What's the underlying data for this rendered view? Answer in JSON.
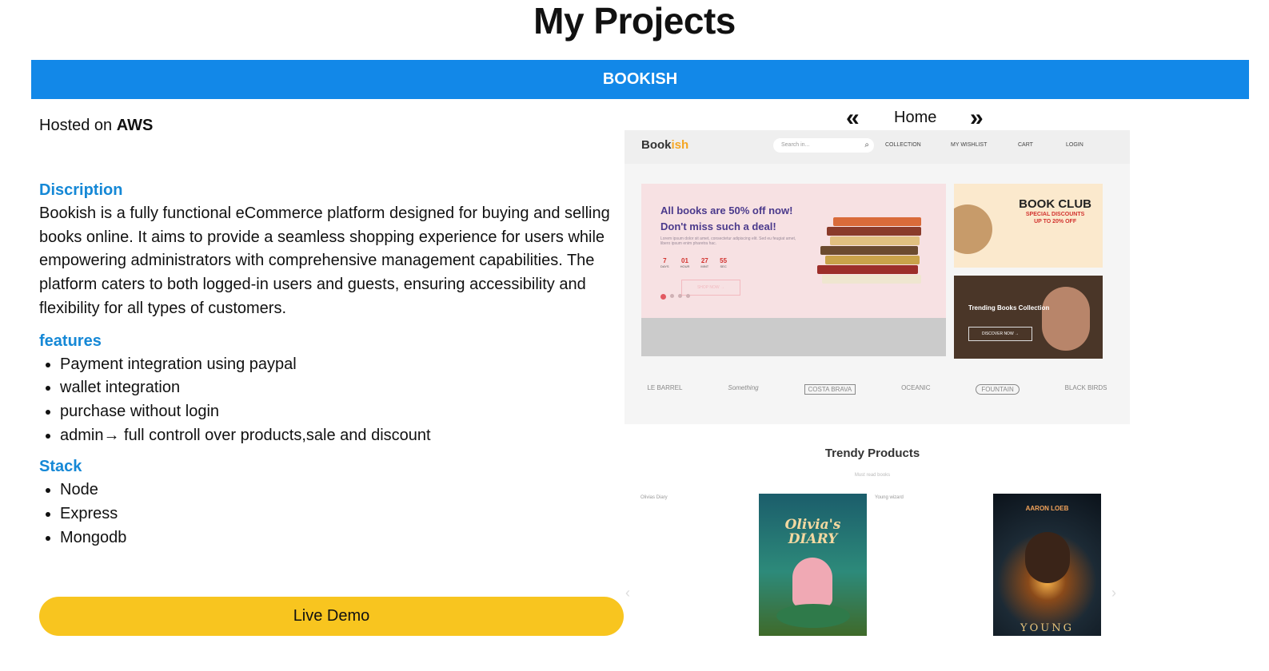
{
  "page_title": "My Projects",
  "project": {
    "name": "BOOKISH",
    "hosted_prefix": "Hosted on",
    "hosted_platform": "AWS",
    "description_heading": "Discription",
    "description": "Bookish is a fully functional eCommerce platform designed for buying and selling books online. It aims to provide a seamless shopping experience for users while empowering administrators with comprehensive management capabilities. The platform caters to both logged-in users and guests, ensuring accessibility and flexibility for all types of customers.",
    "features_heading": "features",
    "features": [
      "Payment integration using paypal",
      "wallet integration",
      "purchase without login",
      "admin→ full controll over products,sale and discount"
    ],
    "stack_heading": "Stack",
    "stack": [
      "Node",
      "Express",
      "Mongodb"
    ],
    "live_demo_label": "Live Demo"
  },
  "slider": {
    "prev_icon": "«",
    "next_icon": "»",
    "current_label": "Home"
  },
  "screenshot": {
    "logo_main": "Book",
    "logo_accent": "ish",
    "search_placeholder": "Search in...",
    "nav": [
      "COLLECTION",
      "MY WISHLIST",
      "CART",
      "LOGIN"
    ],
    "hero_line1": "All books are 50% off now!",
    "hero_line2": "Don't miss such a deal!",
    "hero_small": "Lorem ipsum dolor sit amet, consectetur adipiscing elit. Sed eu feugiat amet, libero ipsum enim pharetra hac.",
    "countdown": [
      {
        "value": "7",
        "unit": "DAYS"
      },
      {
        "value": "01",
        "unit": "HOUR"
      },
      {
        "value": "27",
        "unit": "MINT"
      },
      {
        "value": "55",
        "unit": "SEC"
      }
    ],
    "shop_now": "SHOP NOW →",
    "club_title": "BOOK CLUB",
    "club_sub1": "SPECIAL DISCOUNTS",
    "club_sub2": "UP TO 20% OFF",
    "trending_label": "Trending Books Collection",
    "discover_label": "DISCOVER NOW →",
    "brands": [
      "LE BARREL",
      "Something",
      "COSTA BRAVA",
      "OCEANIC",
      "FOUNTAIN",
      "BLACK BIRDS"
    ],
    "trendy_title": "Trendy Products",
    "trendy_sub": "Must read books",
    "product1_name": "Olivias Diary",
    "product2_name": "Young wizard",
    "cover1_title": "Olivia's DIARY",
    "cover2_author": "AARON LOEB",
    "cover2_title": "YOUNG"
  },
  "colors": {
    "bar_blue": "#1288e8",
    "heading_blue": "#1588d6",
    "demo_yellow": "#f8c51f"
  }
}
